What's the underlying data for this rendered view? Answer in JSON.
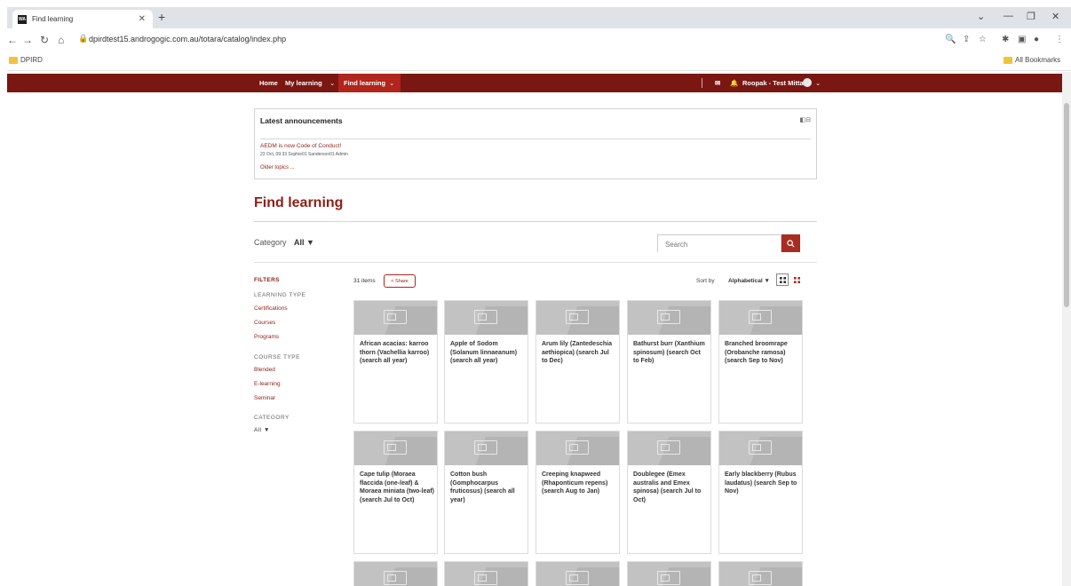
{
  "browser": {
    "tab_title": "Find learning",
    "tab_favicon_text": "WA",
    "url": "dpirdtest15.androgogic.com.au/totara/catalog/index.php",
    "bookmarks": [
      "DPIRD"
    ],
    "all_bookmarks_label": "All Bookmarks"
  },
  "nav": {
    "home": "Home",
    "my_learning": "My learning",
    "find_learning": "Find learning",
    "user": "Roopak - Test Mittal"
  },
  "announcements": {
    "title": "Latest announcements",
    "item_title": "AEDM is now Code of Conduct!",
    "item_meta": "23 Oct, 09:33 Sophie01 Sanderson01 Admin",
    "older": "Older topics ..."
  },
  "page": {
    "title": "Find learning",
    "category_label": "Category",
    "category_value": "All",
    "search_placeholder": "Search"
  },
  "filters": {
    "heading": "FILTERS",
    "learning_type_label": "LEARNING TYPE",
    "learning_types": [
      "Certifications",
      "Courses",
      "Programs"
    ],
    "course_type_label": "COURSE TYPE",
    "course_types": [
      "Blended",
      "E-learning",
      "Seminar"
    ],
    "category_label": "CATEGORY",
    "category_value": "All"
  },
  "results": {
    "count": "31 items",
    "share": "Share",
    "sort_label": "Sort by",
    "sort_value": "Alphabetical"
  },
  "cards": [
    "African acacias: karroo thorn (Vachellia karroo) (search all year)",
    "Apple of Sodom (Solanum linnaeanum) (search all year)",
    "Arum lily (Zantedeschia aethiopica) (search Jul to Dec)",
    "Bathurst burr (Xanthium spinosum) (search Oct to Feb)",
    "Branched broomrape (Orobanche ramosa) (search Sep to Nov)",
    "Cape tulip (Moraea flaccida (one-leaf) & Moraea miniata (two-leaf) (search Jul to Oct)",
    "Cotton bush (Gomphocarpus fruticosus) (search all year)",
    "Creeping knapweed (Rhaponticum repens) (search Aug to Jan)",
    "Doublegee (Emex australis and Emex spinosa) (search Jul to Oct)",
    "Early blackberry (Rubus laudatus) (search Sep to Nov)"
  ]
}
